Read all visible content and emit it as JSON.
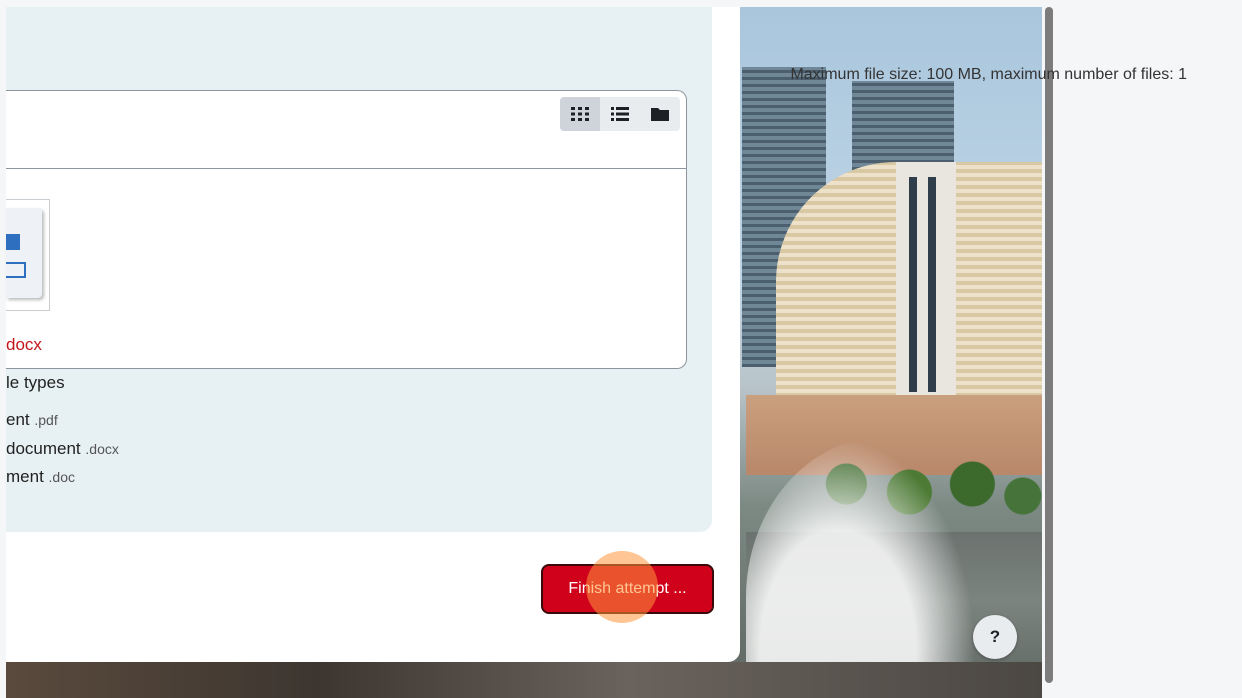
{
  "filemanager": {
    "max_info": "Maximum file size: 100 MB, maximum number of files: 1",
    "views": [
      {
        "name": "grid-view-icon",
        "active": true
      },
      {
        "name": "list-view-icon",
        "active": false
      },
      {
        "name": "folder-view-icon",
        "active": false
      }
    ],
    "file": {
      "name": "docx",
      "icon": "word-document-icon"
    }
  },
  "accepted_types": {
    "heading": "le types",
    "items": [
      {
        "label": "ent",
        "ext": ".pdf"
      },
      {
        "label": "document",
        "ext": ".docx"
      },
      {
        "label": "ment",
        "ext": ".doc"
      }
    ]
  },
  "actions": {
    "finish_label": "Finish attempt ..."
  },
  "help": {
    "label": "?"
  },
  "colors": {
    "accent": "#d0021b",
    "panel": "#e7f1f3",
    "file_link": "#c4141b"
  }
}
